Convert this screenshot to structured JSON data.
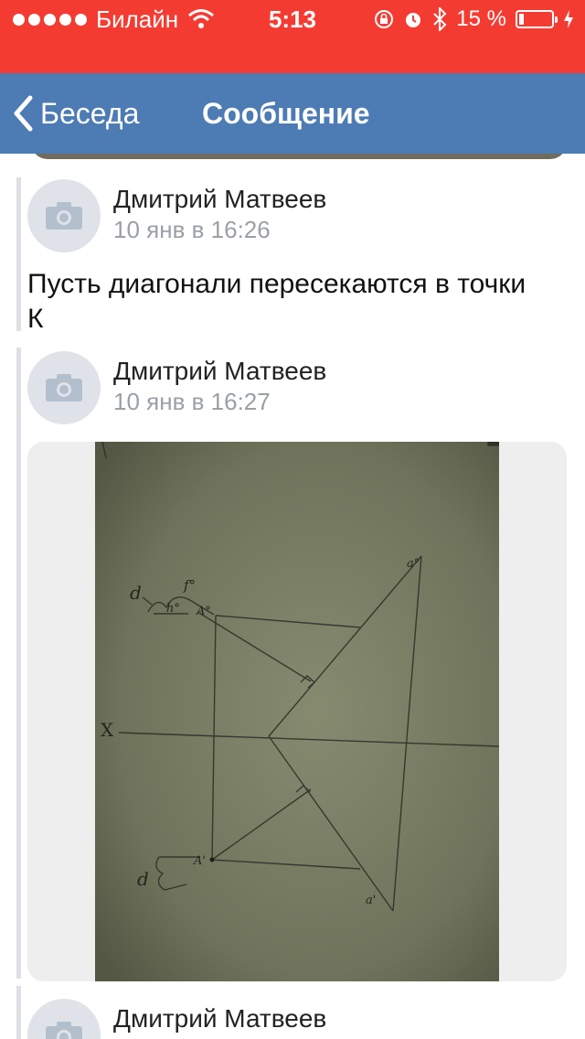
{
  "status_bar": {
    "carrier": "Билайн",
    "time": "5:13",
    "battery_text": "15 %",
    "battery_level": 0.15,
    "icons": [
      "signal-dots-icon",
      "wifi-icon",
      "rotation-lock-icon",
      "alarm-icon",
      "bluetooth-icon",
      "battery-icon",
      "charging-icon"
    ]
  },
  "nav": {
    "back_label": "Беседа",
    "title": "Сообщение"
  },
  "posts": [
    {
      "author": "Дмитрий Матвеев",
      "time": "10 янв в 16:26",
      "text": "Пусть диагонали пересекаются в точки К"
    },
    {
      "author": "Дмитрий Матвеев",
      "time": "10 янв в 16:27",
      "has_photo": true
    },
    {
      "author": "Дмитрий Матвеев"
    }
  ],
  "drawing_labels": {
    "d_top": "d",
    "f": "f°",
    "h": "h°",
    "A_top": "A°",
    "a_top": "a°",
    "x": "X",
    "d_bottom": "d",
    "A_bottom": "A'",
    "a_bottom": "a'"
  },
  "colors": {
    "status_bar": "#f43b32",
    "nav_bar": "#4d7bb4",
    "timestamp": "#9aa0a6"
  }
}
